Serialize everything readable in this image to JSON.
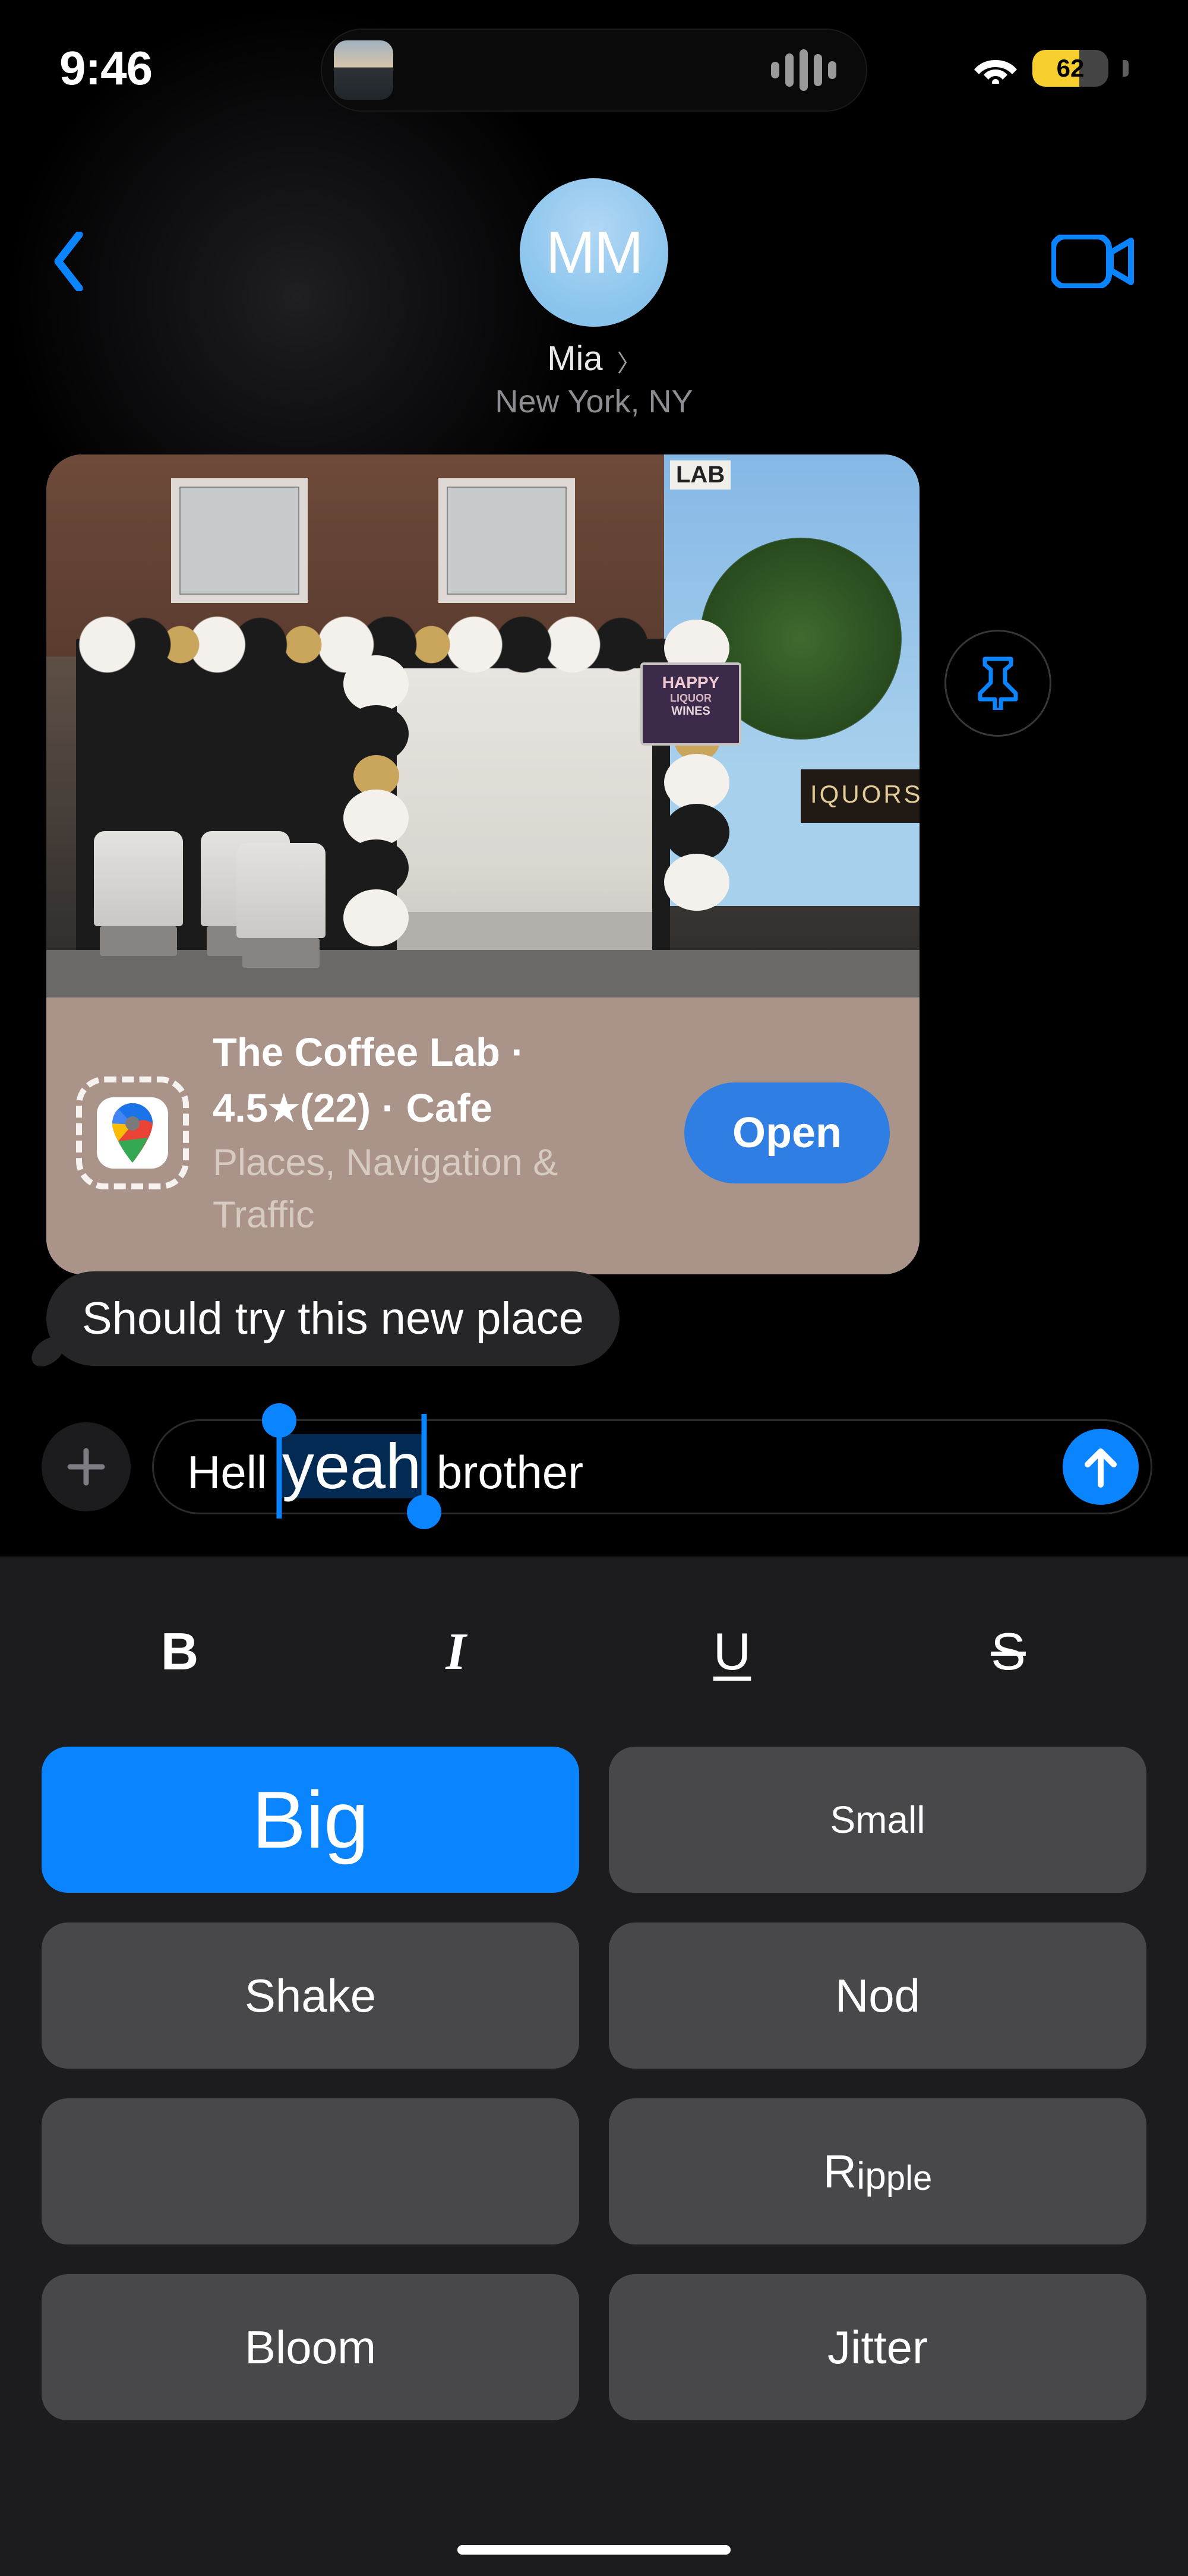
{
  "status": {
    "time": "9:46",
    "battery_percent": "62"
  },
  "header": {
    "avatar_initials": "MM",
    "contact_name": "Mia",
    "contact_location": "New York, NY"
  },
  "place_card": {
    "app_icon": "google-maps-icon",
    "title": "The Coffee Lab",
    "title_sep": " · ",
    "rating": "4.5",
    "review_count": "(22)",
    "category": "Cafe",
    "subtitle": "Places, Navigation & Traffic",
    "open_label": "Open",
    "sign_happy_top": "HAPPY",
    "sign_happy_mid": "LIQUOR",
    "sign_happy_bot": "WINES",
    "sign_liquors": "IQUORS",
    "sign_lab": "LAB"
  },
  "incoming_bubble": {
    "text": "Should try this new place"
  },
  "compose": {
    "pre_text": "Hell ",
    "selected_text": "yeah",
    "post_text": " brother",
    "plus_label": "+"
  },
  "format_row": {
    "bold": "B",
    "italic": "I",
    "underline": "U",
    "strike": "S"
  },
  "effects": {
    "big": "Big",
    "small": "Small",
    "shake": "Shake",
    "nod": "Nod",
    "explode": "",
    "ripple_r": "R",
    "ripple_ip": "ip",
    "ripple_ple": "ple",
    "bloom": "Bloom",
    "jitter": "Jitter"
  }
}
